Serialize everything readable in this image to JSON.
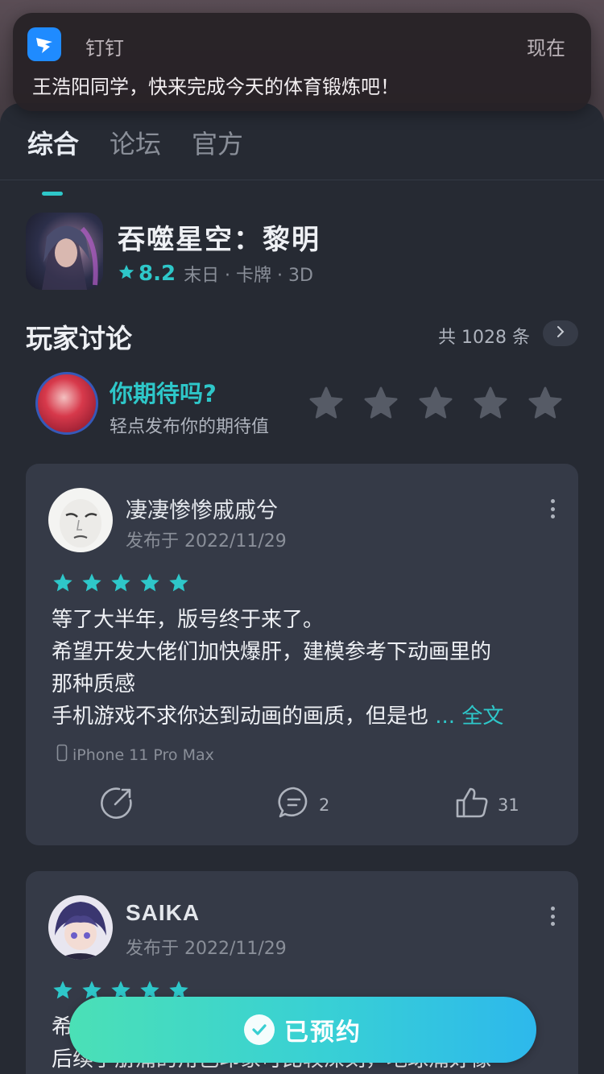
{
  "notification": {
    "app_name": "钉钉",
    "time": "现在",
    "message": "王浩阳同学，快来完成今天的体育锻炼吧！",
    "icon": "dingtalk-icon"
  },
  "tabs": [
    {
      "label": "综合",
      "active": true
    },
    {
      "label": "论坛",
      "active": false
    },
    {
      "label": "官方",
      "active": false
    }
  ],
  "game": {
    "title": "吞噬星空：黎明",
    "rating": "8.2",
    "tags": "末日 · 卡牌 · 3D"
  },
  "discussion": {
    "title": "玩家讨论",
    "count_text": "共 1028 条"
  },
  "expectation": {
    "question": "你期待吗?",
    "subtitle": "轻点发布你的期待值",
    "stars_total": 5
  },
  "reviews": [
    {
      "author": "凄凄惨惨戚戚兮",
      "date": "发布于 2022/11/29",
      "stars": 5,
      "lines": [
        "等了大半年，版号终于来了。",
        "希望开发大佬们加快爆肝，建模参考下动画里的",
        "那种质感",
        "手机游戏不求你达到动画的画质，但是也"
      ],
      "more_text": "... 全文",
      "device": "iPhone 11 Pro Max",
      "comments": "2",
      "likes": "31"
    },
    {
      "author": "SAIKA",
      "date": "发布于 2022/11/29",
      "stars": 5,
      "lines": [
        "希",
        "后续手册痛的角色印象可比较深刻，地球痛好像"
      ]
    }
  ],
  "reserve_button": {
    "label": "已预约"
  },
  "colors": {
    "accent": "#2ec7c9",
    "background": "#262a33",
    "card": "#353a47"
  }
}
